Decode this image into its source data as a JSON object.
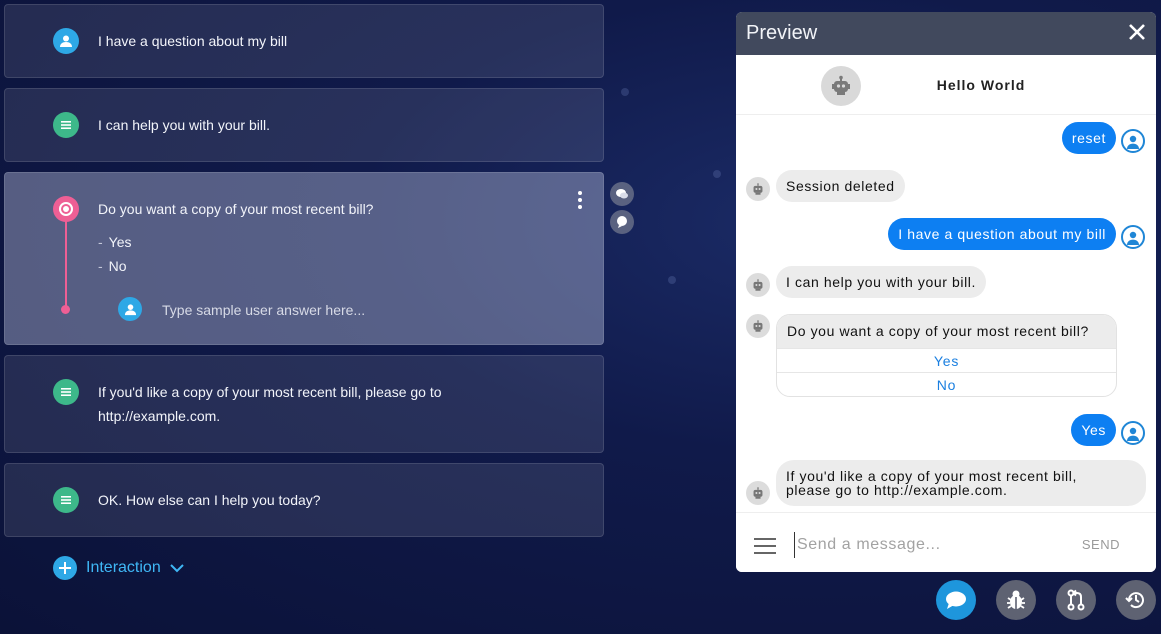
{
  "cards": [
    {
      "icon": "user-icon",
      "text": "I have a question about my bill"
    },
    {
      "icon": "bot-message-icon",
      "text": "I can help you with your bill."
    },
    {
      "icon": "prompt-icon",
      "text": "Do you want a copy of your most recent bill?",
      "options": [
        "Yes",
        "No"
      ],
      "sample_placeholder": "Type sample user answer here..."
    },
    {
      "icon": "bot-message-icon",
      "text_line1": "If you'd like a copy of your most recent bill, please go to",
      "text_line2": "http://example.com."
    },
    {
      "icon": "bot-message-icon",
      "text": "OK. How else can I help you today?"
    }
  ],
  "add_interaction_label": "Interaction",
  "preview": {
    "title": "Preview",
    "bot_name": "Hello World",
    "messages": [
      {
        "from": "user",
        "text": "reset"
      },
      {
        "from": "bot",
        "text": "Session deleted"
      },
      {
        "from": "user",
        "text": "I have a question about my bill"
      },
      {
        "from": "bot",
        "text": "I can help you with your bill."
      },
      {
        "from": "bot",
        "text": "Do you want a copy of your most recent bill?",
        "quick_replies": [
          "Yes",
          "No"
        ]
      },
      {
        "from": "user",
        "text": "Yes"
      },
      {
        "from": "bot",
        "text_line1": "If you'd like a copy of your most recent bill,",
        "text_line2": "please go to http://example.com."
      }
    ],
    "input_placeholder": "Send a message...",
    "send_label": "SEND"
  },
  "toolbar": [
    "chat-icon",
    "bug-icon",
    "merge-icon",
    "history-icon"
  ],
  "colors": {
    "accent": "#2ea8e6",
    "user_bubble": "#0d7ff2",
    "prompt": "#ee5f95",
    "bot": "#3db88a"
  }
}
